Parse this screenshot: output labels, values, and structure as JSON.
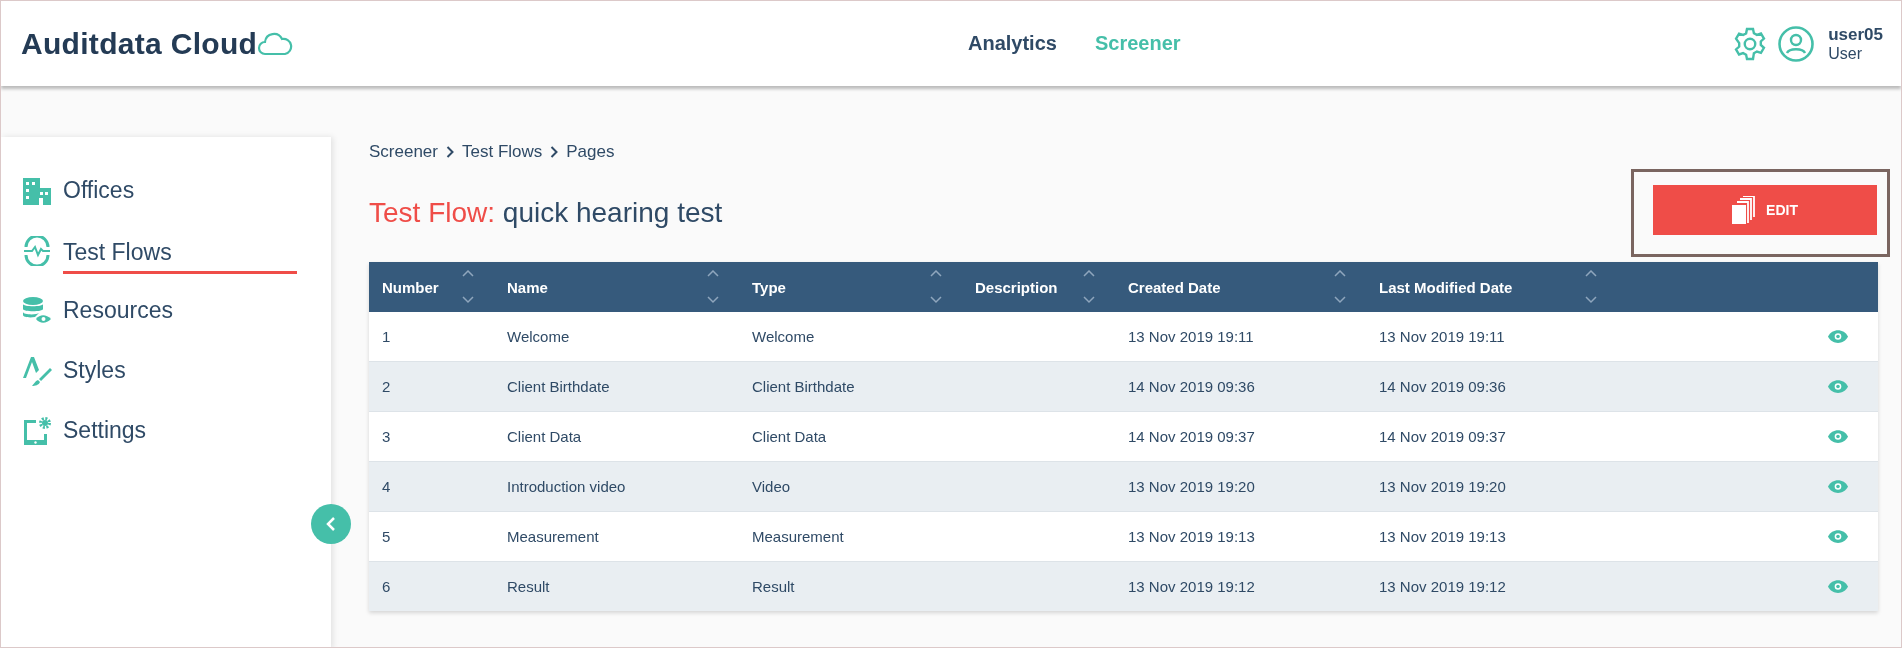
{
  "header": {
    "logo": "Auditdata Cloud",
    "nav": [
      {
        "label": "Analytics",
        "selected": false
      },
      {
        "label": "Screener",
        "selected": true
      }
    ],
    "user": {
      "name": "user05",
      "role": "User"
    }
  },
  "sidebar": {
    "items": [
      {
        "label": "Offices",
        "selected": false
      },
      {
        "label": "Test Flows",
        "selected": true
      },
      {
        "label": "Resources",
        "selected": false
      },
      {
        "label": "Styles",
        "selected": false
      },
      {
        "label": "Settings",
        "selected": false
      }
    ]
  },
  "breadcrumb": [
    "Screener",
    "Test Flows",
    "Pages"
  ],
  "title": {
    "prefix": "Test Flow:",
    "name": "quick hearing test"
  },
  "edit_button": "EDIT",
  "table": {
    "columns": [
      "Number",
      "Name",
      "Type",
      "Description",
      "Created Date",
      "Last Modified Date"
    ],
    "rows": [
      [
        "1",
        "Welcome",
        "Welcome",
        null,
        "13 Nov 2019 19:11",
        "13 Nov 2019 19:11"
      ],
      [
        "2",
        "Client Birthdate",
        "Client Birthdate",
        null,
        "14 Nov 2019 09:36",
        "14 Nov 2019 09:36"
      ],
      [
        "3",
        "Client Data",
        "Client Data",
        null,
        "14 Nov 2019 09:37",
        "14 Nov 2019 09:37"
      ],
      [
        "4",
        "Introduction video",
        "Video",
        null,
        "13 Nov 2019 19:20",
        "13 Nov 2019 19:20"
      ],
      [
        "5",
        "Measurement",
        "Measurement",
        null,
        "13 Nov 2019 19:13",
        "13 Nov 2019 19:13"
      ],
      [
        "6",
        "Result",
        "Result",
        null,
        "13 Nov 2019 19:12",
        "13 Nov 2019 19:12"
      ]
    ]
  }
}
